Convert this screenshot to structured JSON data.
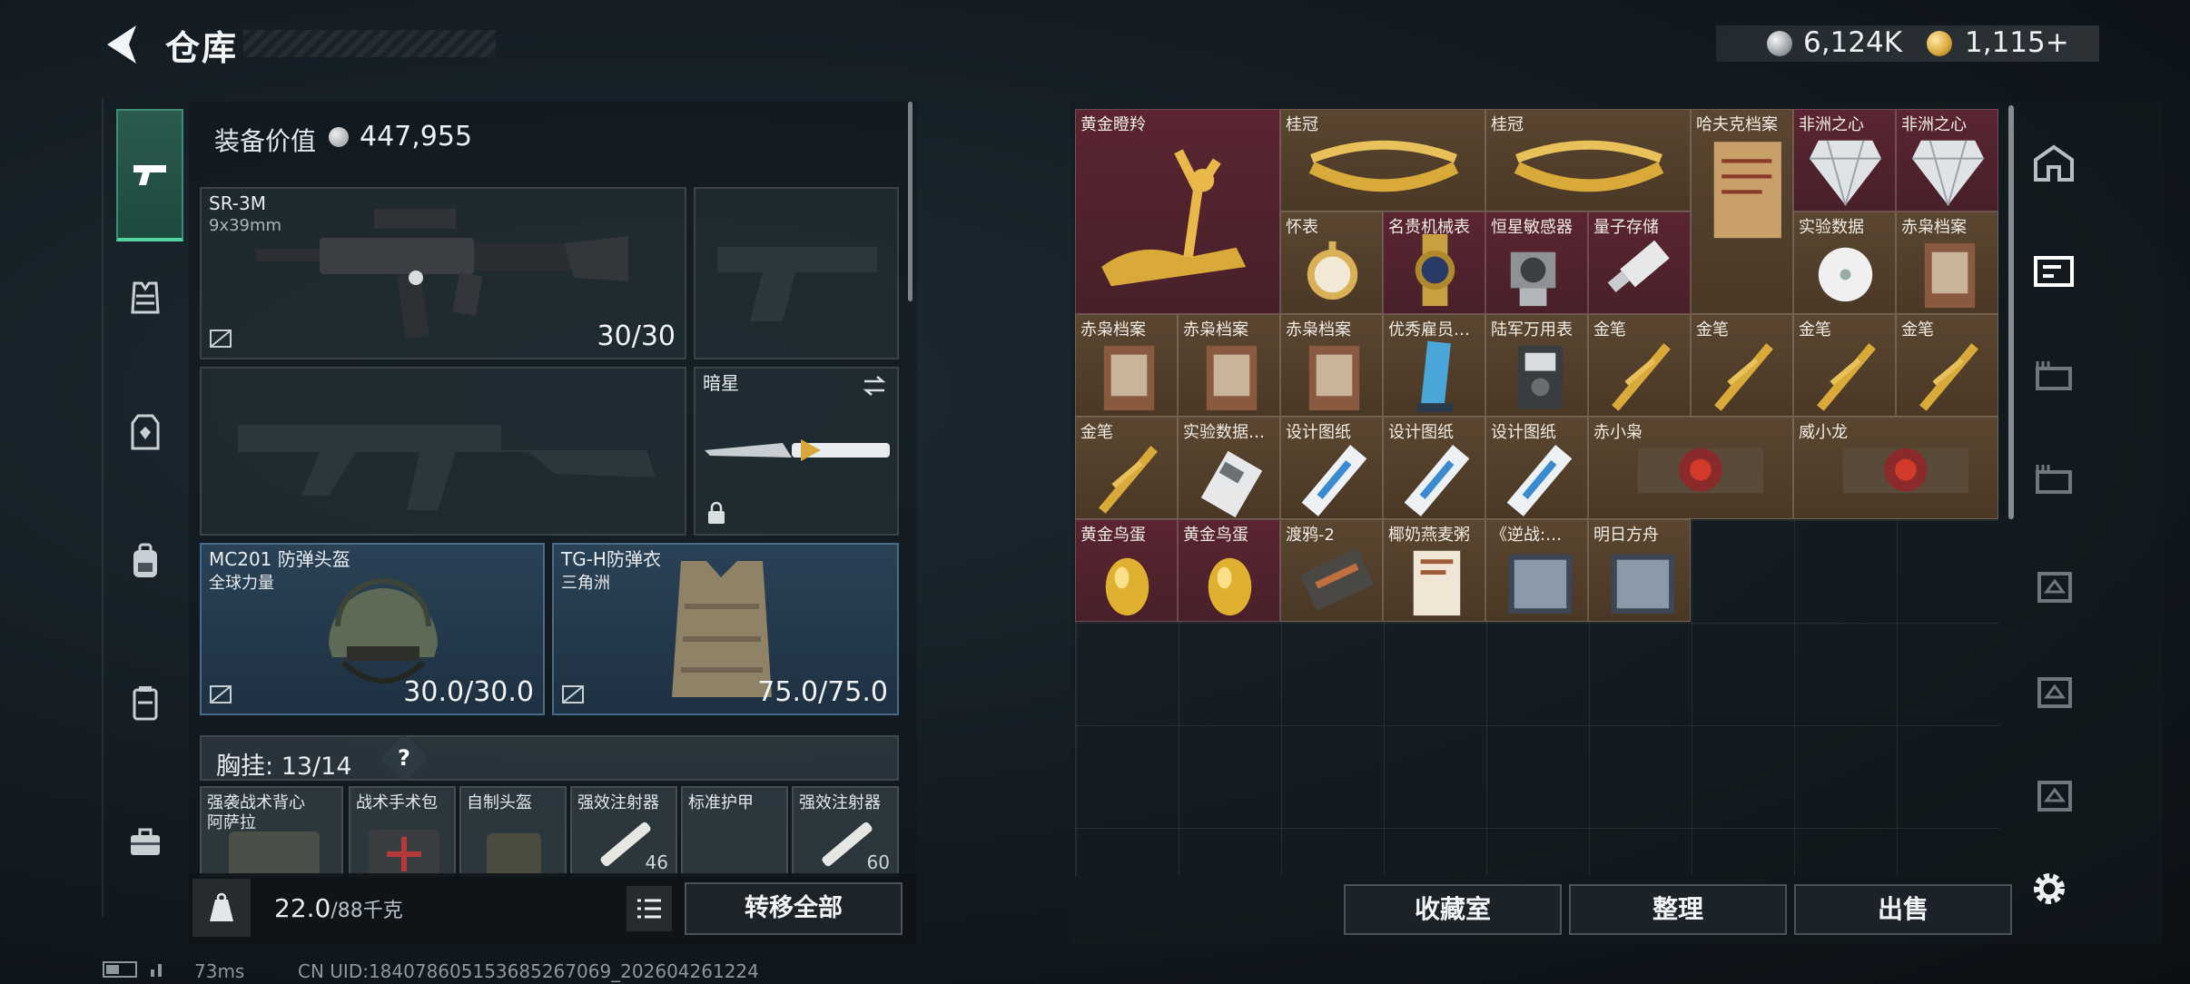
{
  "header": {
    "title": "仓库",
    "currency_silver": "6,124K",
    "currency_gold": "1,115+"
  },
  "loadout": {
    "equip_value_label": "装备价值",
    "equip_value": "447,955",
    "primary": {
      "name": "SR-3M",
      "caliber": "9x39mm",
      "ammo": "30/30"
    },
    "melee": {
      "name": "暗星"
    },
    "helmet": {
      "name": "MC201 防弹头盔",
      "origin": "全球力量",
      "durability": "30.0/30.0"
    },
    "armor": {
      "name": "TG-H防弹衣",
      "origin": "三角洲",
      "durability": "75.0/75.0"
    },
    "chest_rig": {
      "label": "胸挂:",
      "count": "13/14",
      "help": "?"
    },
    "rig_items": [
      {
        "label": "强袭战术背心",
        "sub": "阿萨拉",
        "count": ""
      },
      {
        "label": "战术手术包",
        "count": ""
      },
      {
        "label": "自制头盔",
        "count": ""
      },
      {
        "label": "强效注射器",
        "count": "46"
      },
      {
        "label": "标准护甲",
        "count": ""
      },
      {
        "label": "强效注射器",
        "count": "60"
      }
    ],
    "weight": "22.0",
    "weight_max": "/88千克",
    "transfer_all": "转移全部"
  },
  "stash": {
    "items": [
      {
        "label": "黄金瞪羚",
        "tone": "red",
        "icon": "gazelle-icon"
      },
      {
        "label": "桂冠",
        "tone": "gold",
        "icon": "laurel-icon"
      },
      {
        "label": "桂冠",
        "tone": "gold",
        "icon": "laurel-icon"
      },
      {
        "label": "哈夫克档案",
        "tone": "gold",
        "icon": "file-icon"
      },
      {
        "label": "非洲之心",
        "tone": "red",
        "icon": "diamond-icon"
      },
      {
        "label": "非洲之心",
        "tone": "red",
        "icon": "diamond-icon"
      },
      {
        "label": "怀表",
        "tone": "gold",
        "icon": "pocketwatch-icon"
      },
      {
        "label": "名贵机械表",
        "tone": "red",
        "icon": "watch-icon"
      },
      {
        "label": "恒星敏感器",
        "tone": "red",
        "icon": "sensor-icon"
      },
      {
        "label": "量子存储",
        "tone": "red",
        "icon": "usb-icon"
      },
      {
        "label": "实验数据",
        "tone": "gold",
        "icon": "disc-icon"
      },
      {
        "label": "赤枭档案",
        "tone": "gold",
        "icon": "dossier-icon"
      },
      {
        "label": "赤枭档案",
        "tone": "gold",
        "icon": "dossier-icon"
      },
      {
        "label": "赤枭档案",
        "tone": "gold",
        "icon": "dossier-icon"
      },
      {
        "label": "赤枭档案",
        "tone": "gold",
        "icon": "dossier-icon"
      },
      {
        "label": "优秀雇员…",
        "tone": "gold",
        "icon": "trophy-icon"
      },
      {
        "label": "陆军万用表",
        "tone": "gold",
        "icon": "multimeter-icon"
      },
      {
        "label": "金笔",
        "tone": "gold",
        "icon": "pen-icon"
      },
      {
        "label": "金笔",
        "tone": "gold",
        "icon": "pen-icon"
      },
      {
        "label": "金笔",
        "tone": "gold",
        "icon": "pen-icon"
      },
      {
        "label": "金笔",
        "tone": "gold",
        "icon": "pen-icon"
      },
      {
        "label": "金笔",
        "tone": "gold",
        "icon": "pen-icon"
      },
      {
        "label": "实验数据…",
        "tone": "gold",
        "icon": "drive-icon"
      },
      {
        "label": "设计图纸",
        "tone": "gold",
        "icon": "blueprint-icon"
      },
      {
        "label": "设计图纸",
        "tone": "gold",
        "icon": "blueprint-icon"
      },
      {
        "label": "设计图纸",
        "tone": "gold",
        "icon": "blueprint-icon"
      },
      {
        "label": "赤小枭",
        "tone": "gold",
        "icon": "figure-icon"
      },
      {
        "label": "威小龙",
        "tone": "gold",
        "icon": "figure-icon"
      },
      {
        "label": "黄金鸟蛋",
        "tone": "red",
        "icon": "egg-icon"
      },
      {
        "label": "黄金鸟蛋",
        "tone": "red",
        "icon": "egg-icon"
      },
      {
        "label": "渡鸦-2",
        "tone": "gold",
        "icon": "card-icon"
      },
      {
        "label": "椰奶燕麦粥",
        "tone": "gold",
        "icon": "box-icon"
      },
      {
        "label": "《逆战:…",
        "tone": "gold",
        "icon": "disc-box-icon"
      },
      {
        "label": "明日方舟",
        "tone": "gold",
        "icon": "disc-box-icon"
      }
    ],
    "buttons": {
      "collection": "收藏室",
      "sort": "整理",
      "sell": "出售"
    }
  },
  "status": {
    "ping": "73ms",
    "uid": "CN UID:184078605153685267069_202604261224"
  }
}
